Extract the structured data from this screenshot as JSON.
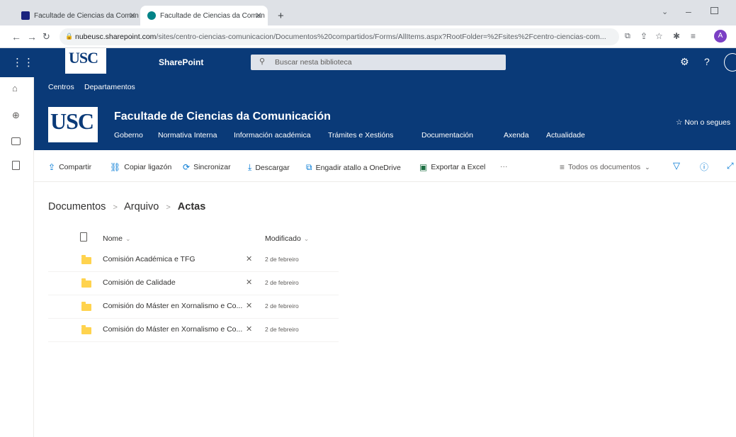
{
  "browser": {
    "tabs": [
      {
        "title": "Facultade de Ciencias da Comun",
        "active": false,
        "favicon_color": "#1a237e"
      },
      {
        "title": "Facultade de Ciencias da Comun",
        "active": true,
        "favicon_color": "#038387"
      }
    ],
    "new_tab": "+",
    "url_host": "nubeusc.sharepoint.com",
    "url_path": "/sites/centro-ciencias-comunicacion/Documentos%20compartidos/Forms/AllItems.aspx?RootFolder=%2Fsites%2Fcentro-ciencias-com...",
    "profile_initial": "A"
  },
  "suite": {
    "logo": "USC",
    "app_name": "SharePoint",
    "search_placeholder": "Buscar nesta biblioteca",
    "help": "?"
  },
  "hub_nav": {
    "items": [
      "Centros",
      "Departamentos"
    ]
  },
  "site": {
    "logo": "USC",
    "title": "Facultade de Ciencias da Comunicación",
    "nav": [
      "Goberno",
      "Normativa Interna",
      "Información académica",
      "Trámites e Xestións",
      "Documentación",
      "Axenda",
      "Actualidade"
    ],
    "follow": "Non o segues"
  },
  "commands": {
    "share": "Compartir",
    "copy_link": "Copiar ligazón",
    "sync": "Sincronizar",
    "download": "Descargar",
    "add_shortcut": "Engadir atallo a OneDrive",
    "export_excel": "Exportar a Excel",
    "more": "···",
    "view": "Todos os documentos"
  },
  "breadcrumb": {
    "items": [
      "Documentos",
      "Arquivo"
    ],
    "current": "Actas",
    "separator": ">"
  },
  "list": {
    "col_name": "Nome",
    "col_modified": "Modificado",
    "rows": [
      {
        "name": "Comisión Académica e TFG",
        "modified": "2 de febreiro"
      },
      {
        "name": "Comisión de Calidade",
        "modified": "2 de febreiro"
      },
      {
        "name": "Comisión do Máster en Xornalismo e Co...",
        "modified": "2 de febreiro"
      },
      {
        "name": "Comisión do Máster en Xornalismo e Co...",
        "modified": "2 de febreiro"
      }
    ]
  },
  "colors": {
    "brand_blue": "#0a3a78",
    "accent": "#0078d4",
    "folder": "#ffd34e"
  }
}
